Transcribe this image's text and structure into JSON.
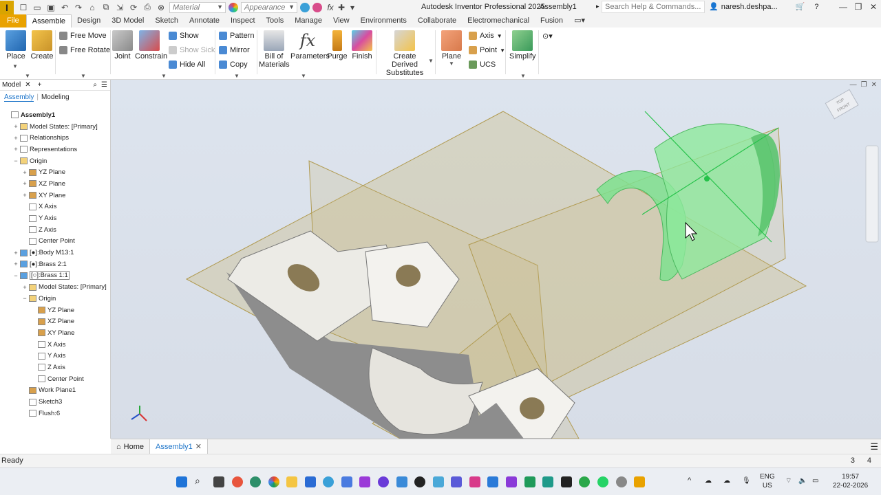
{
  "titlebar": {
    "app_name": "Autodesk Inventor Professional 2025",
    "document": "Assembly1",
    "search_placeholder": "Search Help & Commands...",
    "user": "naresh.deshpa...",
    "material_combo": "Material",
    "appearance_combo": "Appearance"
  },
  "tabs": [
    "File",
    "Assemble",
    "Design",
    "3D Model",
    "Sketch",
    "Annotate",
    "Inspect",
    "Tools",
    "Manage",
    "View",
    "Environments",
    "Collaborate",
    "Electromechanical",
    "Fusion"
  ],
  "ribbon": {
    "place": "Place",
    "create": "Create",
    "free_move": "Free Move",
    "free_rotate": "Free Rotate",
    "joint": "Joint",
    "constrain": "Constrain",
    "show": "Show",
    "show_sick": "Show Sick",
    "hide_all": "Hide All",
    "pattern": "Pattern",
    "mirror": "Mirror",
    "copy": "Copy",
    "bill_of_materials_1": "Bill of",
    "bill_of_materials_2": "Materials",
    "parameters": "Parameters",
    "purge": "Purge",
    "finish": "Finish",
    "create_derived_1": "Create Derived",
    "create_derived_2": "Substitutes",
    "plane": "Plane",
    "axis": "Axis",
    "point": "Point",
    "ucs": "UCS",
    "simplify": "Simplify"
  },
  "browser": {
    "title": "Model",
    "plus": "+",
    "subtab_assembly": "Assembly",
    "subtab_modeling": "Modeling",
    "tree": [
      {
        "label": "Assembly1",
        "indent": 0,
        "exp": "",
        "bold": true
      },
      {
        "label": "Model States: [Primary]",
        "indent": 1,
        "exp": "+"
      },
      {
        "label": "Relationships",
        "indent": 1,
        "exp": "+"
      },
      {
        "label": "Representations",
        "indent": 1,
        "exp": "+"
      },
      {
        "label": "Origin",
        "indent": 1,
        "exp": "−"
      },
      {
        "label": "YZ Plane",
        "indent": 2,
        "exp": "+"
      },
      {
        "label": "XZ Plane",
        "indent": 2,
        "exp": "+"
      },
      {
        "label": "XY Plane",
        "indent": 2,
        "exp": "+"
      },
      {
        "label": "X Axis",
        "indent": 2,
        "exp": ""
      },
      {
        "label": "Y Axis",
        "indent": 2,
        "exp": ""
      },
      {
        "label": "Z Axis",
        "indent": 2,
        "exp": ""
      },
      {
        "label": "Center Point",
        "indent": 2,
        "exp": ""
      },
      {
        "label": "[●]:Body M13:1",
        "indent": 1,
        "exp": "+"
      },
      {
        "label": "[●]:Brass 2:1",
        "indent": 1,
        "exp": "+"
      },
      {
        "label": "[○]:Brass 1:1",
        "indent": 1,
        "exp": "−"
      },
      {
        "label": "Model States: [Primary]",
        "indent": 2,
        "exp": "+"
      },
      {
        "label": "Origin",
        "indent": 2,
        "exp": "−"
      },
      {
        "label": "YZ Plane",
        "indent": 3,
        "exp": ""
      },
      {
        "label": "XZ Plane",
        "indent": 3,
        "exp": ""
      },
      {
        "label": "XY Plane",
        "indent": 3,
        "exp": ""
      },
      {
        "label": "X Axis",
        "indent": 3,
        "exp": ""
      },
      {
        "label": "Y Axis",
        "indent": 3,
        "exp": ""
      },
      {
        "label": "Z Axis",
        "indent": 3,
        "exp": ""
      },
      {
        "label": "Center Point",
        "indent": 3,
        "exp": ""
      },
      {
        "label": "Work Plane1",
        "indent": 2,
        "exp": ""
      },
      {
        "label": "Sketch3",
        "indent": 2,
        "exp": ""
      },
      {
        "label": "Flush:6",
        "indent": 2,
        "exp": ""
      }
    ]
  },
  "viewcube": {
    "top": "TOP",
    "front": "FRONT"
  },
  "doc_tabs": {
    "home": "Home",
    "assembly": "Assembly1"
  },
  "status": {
    "text": "Ready",
    "n1": "3",
    "n2": "4"
  },
  "taskbar": {
    "lang1": "ENG",
    "lang2": "US",
    "time": "19:57",
    "date": "22-02-2026"
  },
  "colors": {
    "file_tab": "#e9a200",
    "accent": "#1a73c9",
    "brass_green": "#7fe08f",
    "plane_tan": "#c9b77a"
  }
}
